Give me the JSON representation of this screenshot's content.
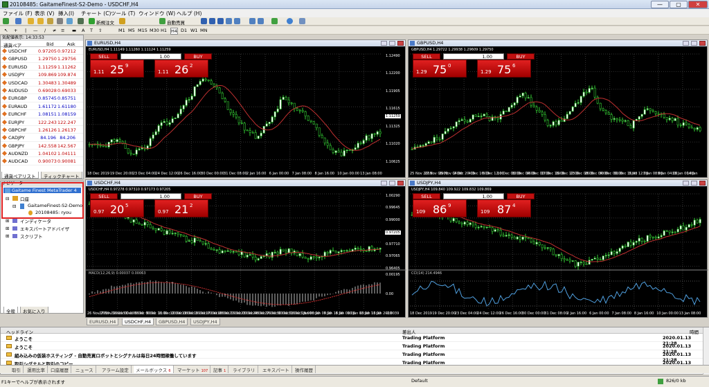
{
  "window": {
    "title": "20108485: GaitameFinest-S2-Demo - USDCHF,H4",
    "min": "—",
    "max": "▢",
    "close": "✕"
  },
  "menu": [
    "ファイル (F)",
    "表示 (V)",
    "挿入(I)",
    "チャート (C)",
    "ツール (T)",
    "ウィンドウ (W)",
    "ヘルプ (H)"
  ],
  "toolbar": {
    "new_order": "新規注文",
    "auto_trading": "自動売買",
    "timeframes": [
      "M1",
      "M5",
      "M15",
      "M30",
      "H1",
      "H4",
      "D1",
      "W1",
      "MN"
    ],
    "text_tool": "A",
    "label_tool": "T"
  },
  "market_watch": {
    "header": "気配値表示: 14:33:53",
    "col_symbol": "通貨ペア",
    "col_bid": "Bid",
    "col_ask": "Ask",
    "rows": [
      [
        "USDCHF",
        "0.97205",
        "0.97212",
        "red"
      ],
      [
        "GBPUSD",
        "1.29750",
        "1.29756",
        "red"
      ],
      [
        "EURUSD",
        "1.11259",
        "1.11262",
        "red"
      ],
      [
        "USDJPY",
        "109.869",
        "109.874",
        "red"
      ],
      [
        "USDCAD",
        "1.30483",
        "1.30489",
        "red"
      ],
      [
        "AUDUSD",
        "0.69028",
        "0.69033",
        "red"
      ],
      [
        "EURGBP",
        "0.85745",
        "0.85751",
        "blue"
      ],
      [
        "EURAUD",
        "1.61172",
        "1.61180",
        "blue"
      ],
      [
        "EURCHF",
        "1.08151",
        "1.08159",
        "blue"
      ],
      [
        "EURJPY",
        "122.243",
        "122.247",
        "red"
      ],
      [
        "GBPCHF",
        "1.26126",
        "1.26137",
        "red"
      ],
      [
        "CADJPY",
        "84.196",
        "84.206",
        "blue"
      ],
      [
        "GBPJPY",
        "142.558",
        "142.567",
        "red"
      ],
      [
        "AUDNZD",
        "1.04102",
        "1.04111",
        "red"
      ],
      [
        "AUDCAD",
        "0.90073",
        "0.90081",
        "red"
      ]
    ],
    "tab_list": "通貨ペアリスト",
    "tab_tick": "ティックチャート"
  },
  "navigator": {
    "header": "ナビゲーター",
    "root": "Gaitame Finest MetaTrader 4",
    "accounts": "口座",
    "server": "GaitameFinest-S2-Demo",
    "login": "20108485: ryou",
    "indicators": "インディケータ",
    "experts": "エキスパートアドバイザ",
    "scripts": "スクリプト",
    "tab_common": "全般",
    "tab_fav": "お気に入り"
  },
  "charts": [
    {
      "title": "EURUSD,H4",
      "ohlc": "EURUSD,H4  1.11149 1.11260 1.11124 1.11259",
      "sell_big": "25",
      "sell_pre": "1.11",
      "sell_sup": "9",
      "buy_big": "26",
      "buy_pre": "1.11",
      "buy_sup": "2",
      "lot": "1.00",
      "yticks": [
        "1.12490",
        "1.12200",
        "1.11905",
        "1.11615",
        "1.11325",
        "1.11020",
        "1.10625"
      ],
      "last_price": "1.11259",
      "xticks": [
        "18 Dec 2019",
        "19 Dec 20:00",
        "23 Dec 04:00",
        "24 Dec 12:00",
        "26 Dec 16:00",
        "30 Dec 00:00",
        "31 Dec 08:00",
        "2 Jan 16:00",
        "6 Jan 00:00",
        "7 Jan 08:00",
        "8 Jan 16:00",
        "10 Jan 00:00",
        "13 Jan 08:00"
      ]
    },
    {
      "title": "GBPUSD,H4",
      "ohlc": "GBPUSD,H4  1.29722 1.29938 1.29609 1.29750",
      "sell_big": "75",
      "sell_pre": "1.29",
      "sell_sup": "0",
      "buy_big": "75",
      "buy_pre": "1.29",
      "buy_sup": "6",
      "lot": "1.00",
      "yticks": [],
      "last_price": "",
      "xticks": [
        "25 Nov 2019",
        "27 Nov 08:00",
        "29 Nov 04:00",
        "2 Dec 20:00",
        "4 Dec 16:00",
        "6 Dec 12:00",
        "10 Dec 08:00",
        "12 Dec 04:00",
        "16 Dec 00:00",
        "17 Dec 16:00",
        "19 Dec 12:00",
        "23 Dec 08:00",
        "26 Dec 04:00",
        "30 Dec 00:00",
        "31 Dec 16:00",
        "3 Jan 12:00",
        "7 Jan 08:00",
        "9 Jan 04:00",
        "13 Jan 00:00",
        "14 Jan"
      ]
    },
    {
      "title": "USDCHF,H4",
      "ohlc": "USDCHF,H4  0.97278 0.97310 0.97173 0.97205",
      "sell_big": "20",
      "sell_pre": "0.97",
      "sell_sup": "5",
      "buy_big": "21",
      "buy_pre": "0.97",
      "buy_sup": "2",
      "lot": "1.00",
      "yticks": [
        "1.00290",
        "0.99645",
        "0.99000",
        "0.98355",
        "0.97710",
        "0.97065",
        "0.96405"
      ],
      "last_price": "0.97205",
      "sub_title": "MACD(12,26,9) 0.00037 0.00063",
      "sub_ticks": [
        "0.00195",
        "0.00",
        "-0.0039"
      ],
      "xticks": [
        "26 Nov 2019",
        "27 Nov 16:00",
        "29 Nov 00:00",
        "3 Dec 08:00",
        "5 Dec 00:00",
        "9 Dec 16:00",
        "11 Dec 00:00",
        "12 Dec 08:00",
        "13 Dec 16:00",
        "16 Dec 00:00",
        "17 Dec 08:00",
        "18 Dec 16:00",
        "20 Dec 00:00",
        "23 Dec 08:00",
        "24 Dec 16:00",
        "27 Dec 00:00",
        "30 Dec 08:00",
        "31 Dec 16:00",
        "3 Jan 00:00",
        "6 Jan 08:00",
        "7 Jan 16:00",
        "8 Jan 00:00",
        "10 Jan 08:00",
        "13 Jan 16:00",
        "13 Jan 2020"
      ]
    },
    {
      "title": "USDJPY,H4",
      "ohlc": "USDJPY,H4  109.840 109.922 109.832 109.869",
      "sell_big": "86",
      "sell_pre": "109",
      "sell_sup": "9",
      "buy_big": "87",
      "buy_pre": "109",
      "buy_sup": "4",
      "lot": "1.00",
      "yticks": [],
      "last_price": "",
      "sub_title": "CCI(14) 214.4946",
      "sub_ticks": [],
      "xticks": [
        "18 Dec 2019",
        "19 Dec 20:00",
        "23 Dec 04:00",
        "24 Dec 12:00",
        "26 Dec 16:00",
        "30 Dec 00:00",
        "31 Dec 08:00",
        "2 Jan 16:00",
        "6 Jan 00:00",
        "7 Jan 08:00",
        "8 Jan 16:00",
        "10 Jan 00:00",
        "13 Jan 08:00"
      ]
    }
  ],
  "trade_labels": {
    "sell": "SELL",
    "buy": "BUY"
  },
  "chart_tabs": [
    "EURUSD,H4",
    "USDCHF,H4",
    "GBPUSD,H4",
    "USDJPY,H4"
  ],
  "terminal": {
    "col_headline": "ヘッドライン",
    "col_sender": "差出人",
    "col_time": "時間",
    "rows": [
      [
        "ようこそ",
        "Trading Platform",
        "2020.01.13 21:28"
      ],
      [
        "ようこそ",
        "Trading Platform",
        "2020.01.13 21:28"
      ],
      [
        "組み込みの仮装ホスティング - 自動売買ロボットとシグナルは毎日24時間稼働しています",
        "Trading Platform",
        "2020.01.13 21:28"
      ],
      [
        "取引シグナルと取引のコピー",
        "Trading Platform",
        "2020.01.13 21:28"
      ]
    ],
    "tabs": [
      "取引",
      "運用比率",
      "口座履歴",
      "ニュース",
      "アラーム設定",
      "メールボックス",
      "マーケット",
      "記事",
      "ライブラリ",
      "エキスパート",
      "操作履歴"
    ],
    "mail_badge": "6",
    "market_badge": "107",
    "article_badge": "1",
    "side": "ターミナル"
  },
  "status": {
    "help": "F1キーでヘルプが表示されます",
    "profile": "Default",
    "traffic": "826/0 kb"
  }
}
